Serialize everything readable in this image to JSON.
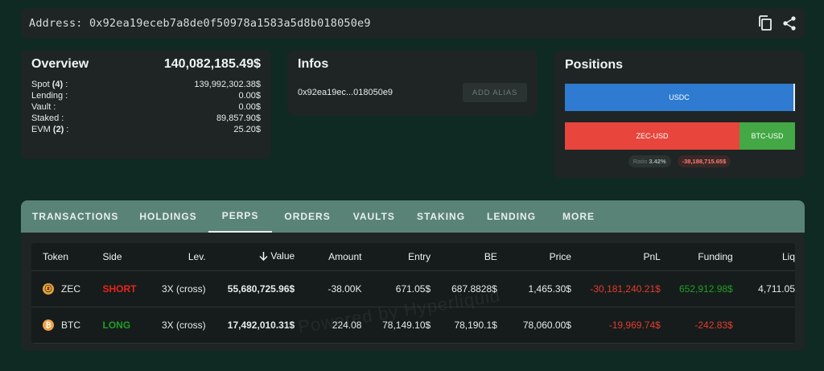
{
  "address_bar": {
    "label": "Address: 0x92ea19eceb7a8de0f50978a1583a5d8b018050e9",
    "icons": [
      "copy-icon",
      "share-icon"
    ]
  },
  "overview": {
    "title": "Overview",
    "total": "140,082,185.49$",
    "rows": [
      {
        "label": "Spot",
        "count": "(4)",
        "suffix": " :",
        "value": "139,992,302.38$"
      },
      {
        "label": "Lending :",
        "count": "",
        "suffix": "",
        "value": "0.00$"
      },
      {
        "label": "Vault :",
        "count": "",
        "suffix": "",
        "value": "0.00$"
      },
      {
        "label": "Staked :",
        "count": "",
        "suffix": "",
        "value": "89,857.90$"
      },
      {
        "label": "EVM",
        "count": "(2)",
        "suffix": " :",
        "value": "25.20$"
      }
    ]
  },
  "infos": {
    "title": "Infos",
    "short_address": "0x92ea19ec...018050e9",
    "add_alias_label": "ADD ALIAS"
  },
  "positions": {
    "title": "Positions",
    "usdc_label": "USDC",
    "zec_label": "ZEC-USD",
    "btc_label": "BTC-USD",
    "ratio_label": "Ratio",
    "ratio_value": "3.42%",
    "pnl_total": "-38,188,715.65$"
  },
  "tabs": [
    {
      "label": "TRANSACTIONS",
      "active": false
    },
    {
      "label": "HOLDINGS",
      "active": false
    },
    {
      "label": "PERPS",
      "active": true
    },
    {
      "label": "ORDERS",
      "active": false
    },
    {
      "label": "VAULTS",
      "active": false
    },
    {
      "label": "STAKING",
      "active": false
    },
    {
      "label": "LENDING",
      "active": false
    },
    {
      "label": "MORE",
      "active": false
    }
  ],
  "table": {
    "headers": {
      "token": "Token",
      "side": "Side",
      "lev": "Lev.",
      "value": "Value",
      "amount": "Amount",
      "entry": "Entry",
      "be": "BE",
      "price": "Price",
      "pnl": "PnL",
      "funding": "Funding",
      "liq": "Liq"
    },
    "sort_icon": "arrow-down-icon",
    "rows": [
      {
        "token": "ZEC",
        "icon": "zec-coin-icon",
        "side": "SHORT",
        "lev": "3X (cross)",
        "value": "55,680,725.96$",
        "amount": "-38.00K",
        "entry": "671.05$",
        "be": "687.8828$",
        "price": "1,465.30$",
        "pnl": "-30,181,240.21$",
        "funding": "652,912.98$",
        "liq": "4,711.05"
      },
      {
        "token": "BTC",
        "icon": "btc-coin-icon",
        "side": "LONG",
        "lev": "3X (cross)",
        "value": "17,492,010.31$",
        "amount": "224.08",
        "entry": "78,149.10$",
        "be": "78,190.1$",
        "price": "78,060.00$",
        "pnl": "-19,969.74$",
        "funding": "-242.83$",
        "liq": ""
      }
    ],
    "watermark": "Powered by Hyperliquid"
  },
  "colors": {
    "background": "#0f2a22",
    "panel": "#1e2524",
    "tab_bar": "#5a8378",
    "usdc": "#2e7bd1",
    "short_bar": "#e8453c",
    "long_bar": "#43a845",
    "negative": "#e23c30",
    "positive": "#1f9f28"
  }
}
